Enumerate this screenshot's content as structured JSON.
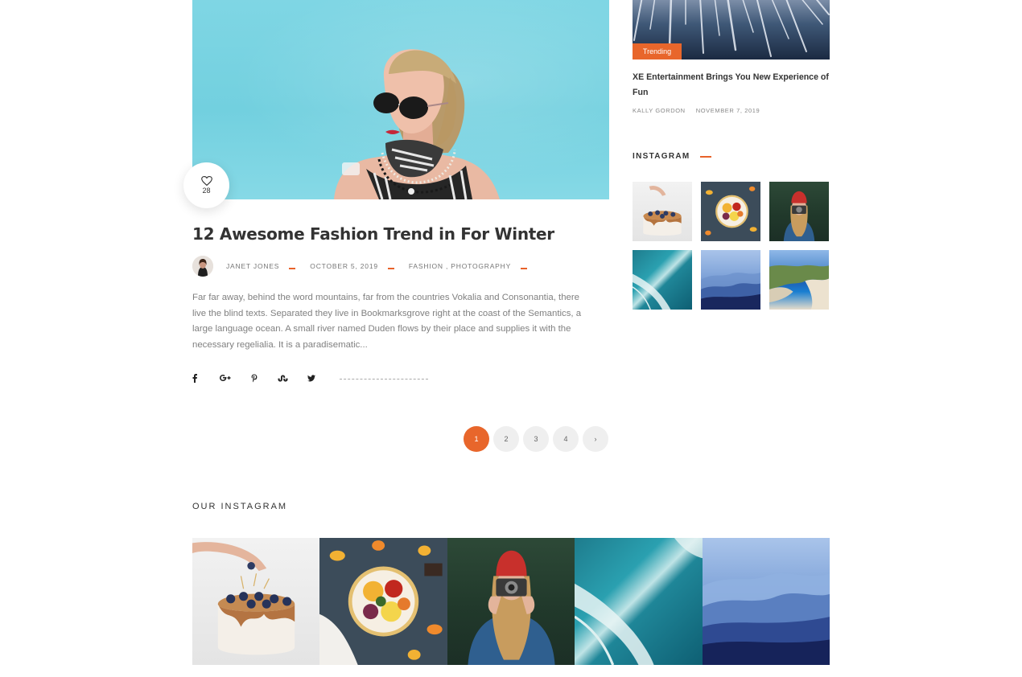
{
  "post": {
    "likes": "28",
    "title": "12 Awesome Fashion Trend in For Winter",
    "author": "JANET JONES",
    "date": "OCTOBER 5, 2019",
    "categories": "FASHION , PHOTOGRAPHY",
    "excerpt": "Far far away, behind the word mountains, far from the countries Vokalia and Consonantia, there live the blind texts. Separated they live in Bookmarksgrove right at the coast of the Semantics, a large language ocean. A small river named Duden flows by their place and supplies it with the necessary regelialia. It is a paradisematic...",
    "share_icons": [
      "facebook-icon",
      "google-plus-icon",
      "pinterest-icon",
      "stumbleupon-icon",
      "twitter-icon"
    ]
  },
  "pagination": {
    "pages": [
      "1",
      "2",
      "3",
      "4"
    ],
    "active": "1",
    "next": "›"
  },
  "sidebar": {
    "trend_tag": "Trending",
    "post_title": "XE Entertainment Brings You New Experience of Fun",
    "post_author": "KALLY GORDON",
    "post_date": "NOVEMBER 7, 2019",
    "instagram_heading": "INSTAGRAM",
    "instagram_images": [
      "cake",
      "fruit-bowl",
      "girl-camera",
      "sea-waves",
      "mountains",
      "coast"
    ]
  },
  "bottom": {
    "heading": "OUR INSTAGRAM",
    "images": [
      "cake",
      "fruit-bowl",
      "girl-camera",
      "sea-waves",
      "mountains"
    ]
  },
  "colors": {
    "accent": "#e8662b",
    "text_dark": "#333333",
    "text_muted": "#808080"
  }
}
